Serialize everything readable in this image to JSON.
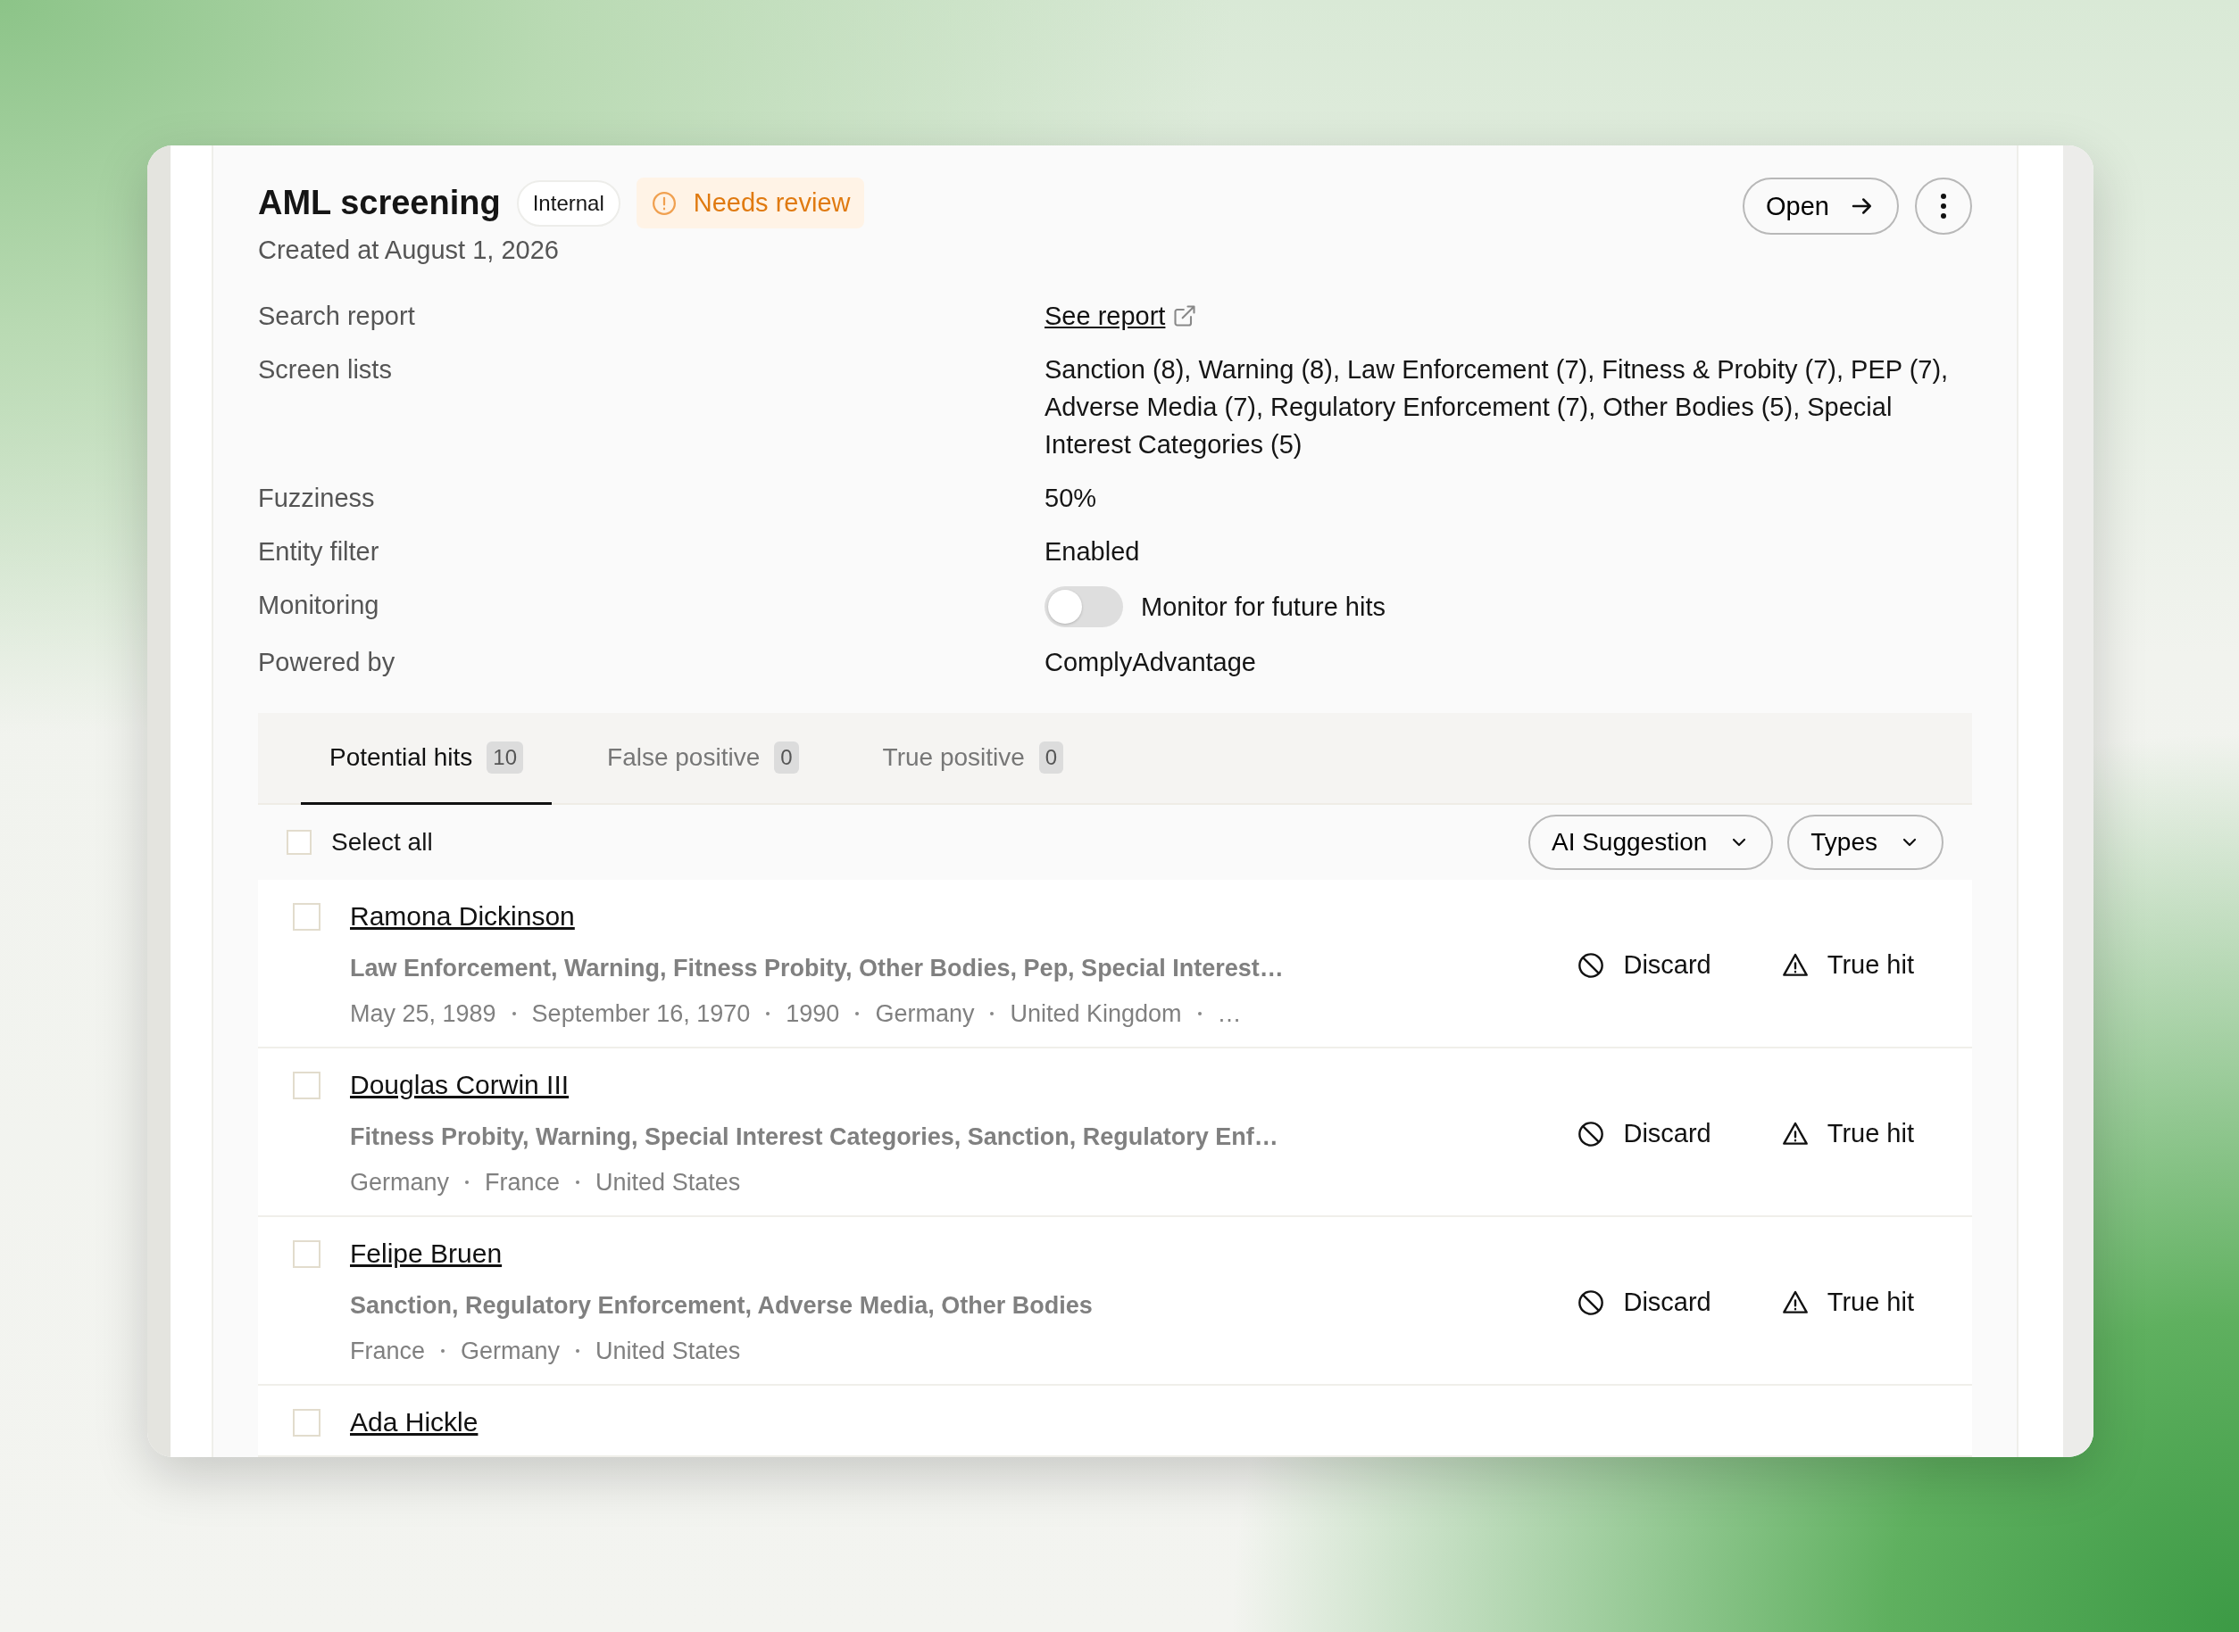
{
  "header": {
    "title": "AML screening",
    "badges": [
      {
        "label": "Internal",
        "kind": "tag"
      },
      {
        "label": "Needs review",
        "kind": "status"
      }
    ],
    "subtitle": "Created at August 1, 2026",
    "open_button": "Open"
  },
  "details": [
    {
      "label": "Search report",
      "kind": "link",
      "value": "See report"
    },
    {
      "label": "Screen lists",
      "kind": "text",
      "value": "Sanction (8), Warning (8), Law Enforcement (7), Fitness & Probity (7), PEP (7), Adverse Media (7), Regulatory Enforcement (7), Other Bodies (5), Special Interest Categories (5)"
    },
    {
      "label": "Fuzziness",
      "kind": "text",
      "value": "50%"
    },
    {
      "label": "Entity filter",
      "kind": "text",
      "value": "Enabled"
    },
    {
      "label": "Monitoring",
      "kind": "toggle",
      "value": "Monitor for future hits",
      "on": false
    },
    {
      "label": "Powered by",
      "kind": "text",
      "value": "ComplyAdvantage"
    }
  ],
  "tabs": [
    {
      "label": "Potential hits",
      "count": "10",
      "selected": true
    },
    {
      "label": "False positive",
      "count": "0",
      "selected": false
    },
    {
      "label": "True positive",
      "count": "0",
      "selected": false
    }
  ],
  "toolbar": {
    "select_all": {
      "label": "Select all",
      "checked": false
    },
    "filters": [
      "AI Suggestion",
      "Types"
    ]
  },
  "hits": [
    {
      "name": "Ramona Dickinson",
      "checked": false,
      "categories": "Law Enforcement, Warning, Fitness Probity, Other Bodies, Pep, Special Interest…",
      "facts": [
        "May 25, 1989",
        "September 16, 1970",
        "1990",
        "Germany",
        "United Kingdom",
        "…"
      ],
      "actions": [
        {
          "label": "Discard",
          "kind": "discard"
        },
        {
          "label": "True hit",
          "kind": "true_hit"
        }
      ]
    },
    {
      "name": "Douglas Corwin III",
      "checked": false,
      "categories": "Fitness Probity, Warning, Special Interest Categories, Sanction, Regulatory Enf…",
      "facts": [
        "Germany",
        "France",
        "United States"
      ],
      "actions": [
        {
          "label": "Discard",
          "kind": "discard"
        },
        {
          "label": "True hit",
          "kind": "true_hit"
        }
      ]
    },
    {
      "name": "Felipe Bruen",
      "checked": false,
      "categories": "Sanction, Regulatory Enforcement, Adverse Media, Other Bodies",
      "facts": [
        "France",
        "Germany",
        "United States"
      ],
      "actions": [
        {
          "label": "Discard",
          "kind": "discard"
        },
        {
          "label": "True hit",
          "kind": "true_hit"
        }
      ]
    },
    {
      "name": "Ada Hickle",
      "checked": false
    }
  ]
}
